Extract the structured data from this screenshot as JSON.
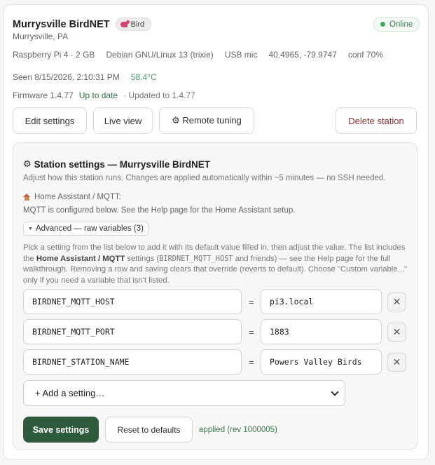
{
  "station": {
    "name": "Murrysville BirdNET",
    "tag": "Bird",
    "location": "Murrysville, PA",
    "status": "Online"
  },
  "hardware": {
    "device": "Raspberry Pi 4 · 2 GB",
    "os": "Debian GNU/Linux 13 (trixie)",
    "mic": "USB mic",
    "coords": "40.4965, -79.9747",
    "conf": "conf 70%"
  },
  "seen": {
    "time": "Seen 8/15/2026, 2:10:31 PM",
    "temp": "58.4°C"
  },
  "firmware": {
    "version": "Firmware 1.4.77",
    "status": "Up to date",
    "updated": "· Updated to 1.4.77"
  },
  "actions": {
    "edit": "Edit settings",
    "live": "Live view",
    "remote": "⚙ Remote tuning",
    "delete": "Delete station"
  },
  "settings_panel": {
    "title": "Station settings — Murrysville BirdNET",
    "subtitle": "Adjust how this station runs. Changes are applied automatically within ~5 minutes — no SSH needed.",
    "ha_label": "Home Assistant / MQTT:",
    "ha_text": "MQTT is configured below. See the Help page for the Home Assistant setup.",
    "advanced_label": "Advanced — raw variables (3)",
    "help_part1": "Pick a setting from the list below to add it with its default value filled in, then adjust the value. The list includes the ",
    "help_bold": "Home Assistant / MQTT",
    "help_part2": " settings (",
    "help_code": "BIRDNET_MQTT_HOST",
    "help_part3": " and friends) — see the Help page for the full walkthrough. Removing a row and saving clears that override (reverts to default). Choose \"Custom variable...\" only if you need a variable that isn't listed.",
    "variables": [
      {
        "key": "BIRDNET_MQTT_HOST",
        "value": "pi3.local"
      },
      {
        "key": "BIRDNET_MQTT_PORT",
        "value": "1883"
      },
      {
        "key": "BIRDNET_STATION_NAME",
        "value": "Powers Valley Birds"
      }
    ],
    "equals": "=",
    "remove_glyph": "✕",
    "add_setting": "+ Add a setting…",
    "save": "Save settings",
    "reset": "Reset to defaults",
    "applied": "applied (rev 1000005)"
  },
  "colors": {
    "online": "#3fae5c",
    "save_button": "#2d5a3a",
    "applied_text": "#3b7a4d",
    "danger_text": "#8b2f2f"
  }
}
